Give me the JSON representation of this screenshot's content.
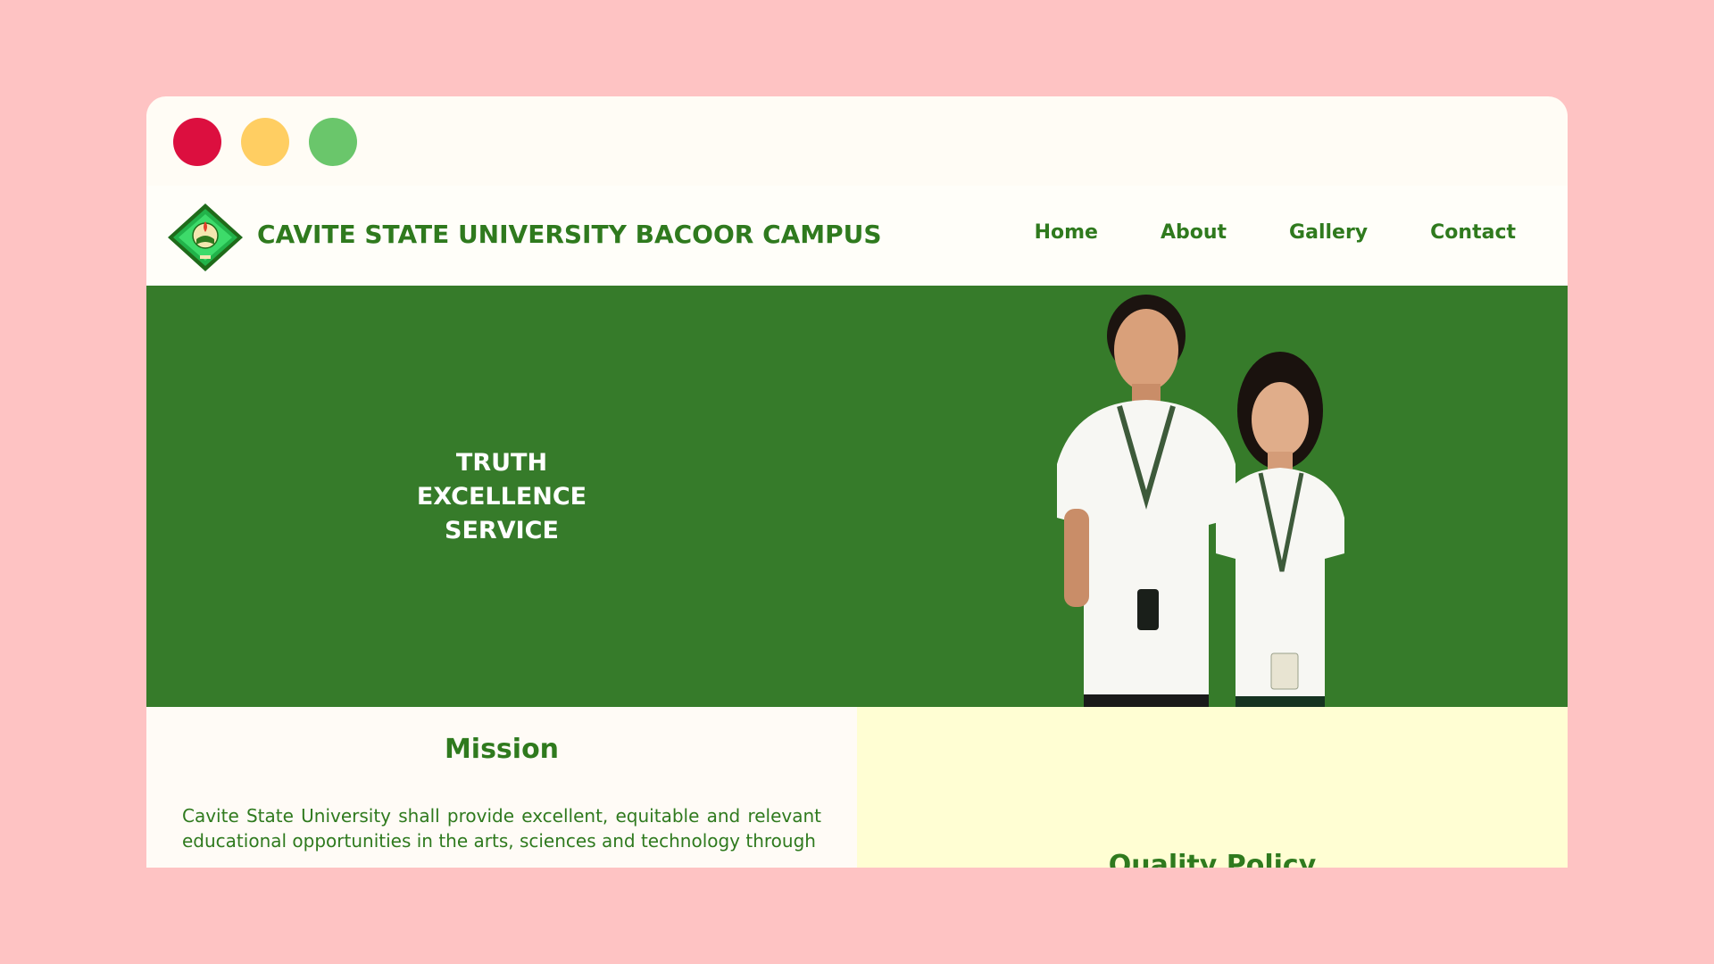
{
  "window": {
    "controls": {
      "close_color": "#DC0F3F",
      "minimize_color": "#FFCE62",
      "maximize_color": "#6AC66B"
    }
  },
  "header": {
    "brand": "CAVITE STATE UNIVERSITY BACOOR CAMPUS",
    "logo_icon": "university-seal-icon",
    "nav": [
      {
        "label": "Home"
      },
      {
        "label": "About"
      },
      {
        "label": "Gallery"
      },
      {
        "label": "Contact"
      }
    ]
  },
  "hero": {
    "motto": [
      "TRUTH",
      "EXCELLENCE",
      "SERVICE"
    ],
    "background_color": "#367B2A",
    "photo_icon": "students-photo"
  },
  "mission": {
    "title": "Mission",
    "text": "Cavite State University shall provide excellent, equitable and relevant educational opportunities in the arts, sciences and technology through"
  },
  "quality": {
    "title": "Quality Policy"
  },
  "colors": {
    "accent": "#2F7A1E",
    "page_bg": "#FEC3C3"
  }
}
